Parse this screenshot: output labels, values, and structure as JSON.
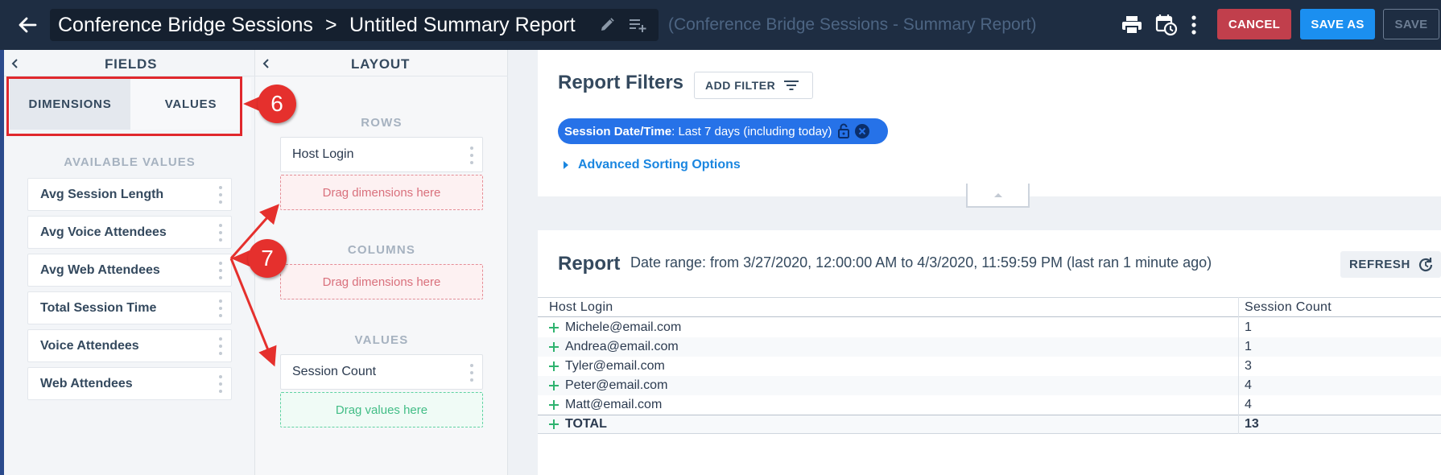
{
  "header": {
    "report_name": "Conference Bridge Sessions",
    "separator": ">",
    "report_title": "Untitled Summary Report",
    "subtitle": "(Conference Bridge Sessions - Summary Report)",
    "cancel_label": "CANCEL",
    "save_as_label": "SAVE AS",
    "save_label": "SAVE",
    "accent_colors": {
      "cancel": "#c13f4c",
      "save_as": "#1b8ff0",
      "bar": "#1e2d42"
    }
  },
  "fields": {
    "title": "FIELDS",
    "tabs": [
      {
        "label": "DIMENSIONS"
      },
      {
        "label": "VALUES"
      }
    ],
    "available_heading": "AVAILABLE VALUES",
    "items": [
      {
        "label": "Avg Session Length"
      },
      {
        "label": "Avg Voice Attendees"
      },
      {
        "label": "Avg Web Attendees"
      },
      {
        "label": "Total Session Time"
      },
      {
        "label": "Voice Attendees"
      },
      {
        "label": "Web Attendees"
      }
    ]
  },
  "layout": {
    "title": "LAYOUT",
    "rows_heading": "ROWS",
    "rows_item": "Host Login",
    "rows_drop": "Drag dimensions here",
    "columns_heading": "COLUMNS",
    "columns_drop": "Drag dimensions here",
    "values_heading": "VALUES",
    "values_item": "Session Count",
    "values_drop": "Drag values here"
  },
  "filters": {
    "title": "Report Filters",
    "add_filter_label": "ADD FILTER",
    "chip_key": "Session Date/Time",
    "chip_value": ": Last 7 days (including today)",
    "advanced_label": "Advanced Sorting Options"
  },
  "report": {
    "title": "Report",
    "date_range": "Date range: from 3/27/2020, 12:00:00 AM to 4/3/2020, 11:59:59 PM (last ran 1 minute ago)",
    "refresh_label": "REFRESH",
    "columns": [
      "Host Login",
      "Session Count"
    ],
    "rows": [
      {
        "host": "Michele@email.com",
        "count": "1"
      },
      {
        "host": "Andrea@email.com",
        "count": "1"
      },
      {
        "host": "Tyler@email.com",
        "count": "3"
      },
      {
        "host": "Peter@email.com",
        "count": "4"
      },
      {
        "host": "Matt@email.com",
        "count": "4"
      }
    ],
    "total": {
      "label": "TOTAL",
      "count": "13"
    }
  },
  "annotations": {
    "badge_6": "6",
    "badge_7": "7",
    "color": "#e5302d"
  }
}
